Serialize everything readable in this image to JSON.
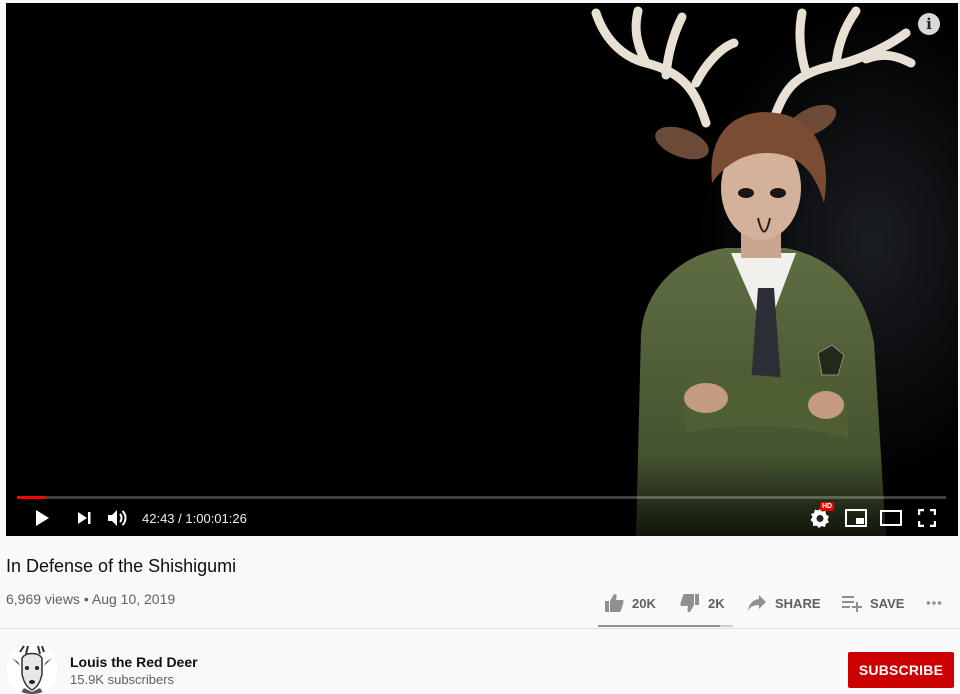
{
  "player": {
    "time_current": "42:43",
    "time_separator": " / ",
    "time_total": "1:00:01:26",
    "progress_fraction": 0.03,
    "hd_badge": "HD",
    "info_glyph": "i"
  },
  "video": {
    "title": "In Defense of the Shishigumi",
    "views": "6,969 views",
    "separator": " • ",
    "date": "Aug 10, 2019"
  },
  "actions": {
    "like_count": "20K",
    "dislike_count": "2K",
    "share_label": "SHARE",
    "save_label": "SAVE",
    "like_fraction": 0.9
  },
  "channel": {
    "name": "Louis the Red Deer",
    "subscribers": "15.9K subscribers",
    "subscribe_label": "SUBSCRIBE"
  },
  "colors": {
    "accent_red": "#cc0000",
    "progress_red": "#ff0000"
  },
  "icons": [
    "info-icon",
    "play-icon",
    "next-icon",
    "volume-icon",
    "settings-icon",
    "miniplayer-icon",
    "theater-icon",
    "fullscreen-icon",
    "like-icon",
    "dislike-icon",
    "share-icon",
    "save-playlist-icon",
    "more-icon"
  ]
}
